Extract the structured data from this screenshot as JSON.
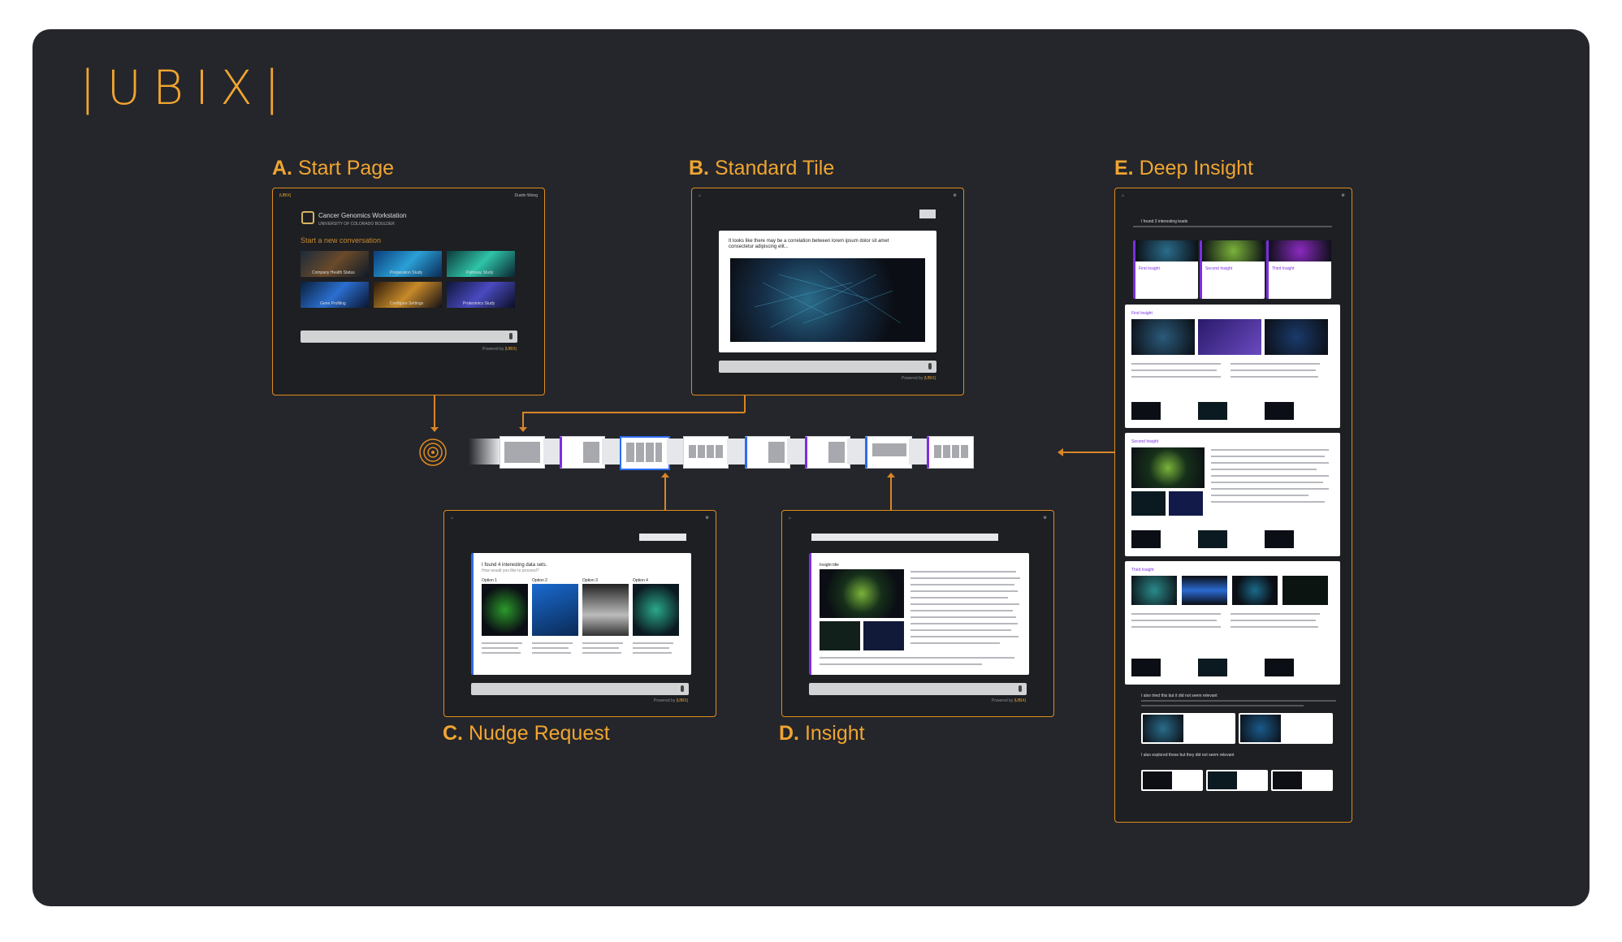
{
  "brand": {
    "logo": "UBIX"
  },
  "sections": {
    "a": {
      "letter": "A.",
      "title": "Start Page"
    },
    "b": {
      "letter": "B.",
      "title": "Standard Tile"
    },
    "c": {
      "letter": "C.",
      "title": "Nudge Request"
    },
    "d": {
      "letter": "D.",
      "title": "Insight"
    },
    "e": {
      "letter": "E.",
      "title": "Deep Insight"
    }
  },
  "start_page": {
    "app_name": "Cancer Genomics Workstation",
    "university": "UNIVERSITY OF COLORADO BOULDER",
    "heading": "Start a new conversation",
    "options": [
      "Company Health Status",
      "Preparation Study",
      "Pathway Study",
      "Gene Profiling",
      "Configure Settings",
      "Proteomics Study"
    ],
    "powered_by": "Powered by",
    "brand_small": "|UBIX|",
    "user": "Dustin Wong"
  },
  "standard_tile": {
    "message": "It looks like there may be a correlation between lorem ipsum dolor sit amet consectetur adipiscing elit...",
    "powered_by": "Powered by",
    "brand_small": "|UBIX|"
  },
  "nudge": {
    "heading": "I found 4 interesting data sets.",
    "sub": "How would you like to proceed?",
    "options": [
      "Option 1",
      "Option 2",
      "Option 3",
      "Option 4"
    ],
    "powered_by": "Powered by",
    "brand_small": "|UBIX|"
  },
  "insight": {
    "title": "Insight title",
    "powered_by": "Powered by",
    "brand_small": "|UBIX|"
  },
  "deep_insight": {
    "header": "I found 3 interesting leads",
    "lead_labels": [
      "First Insight",
      "Second Insight",
      "Third Insight"
    ],
    "sections": [
      "First Insight",
      "Second Insight",
      "Third Insight"
    ],
    "tried_note": "I also tried this but it did not seem relevant",
    "explored_note": "I also explored these but they did not seem relevant"
  },
  "colors": {
    "accent": "#f0a530",
    "board": "#25262b",
    "purple": "#7c2ee0",
    "blue": "#2a6cf0"
  }
}
